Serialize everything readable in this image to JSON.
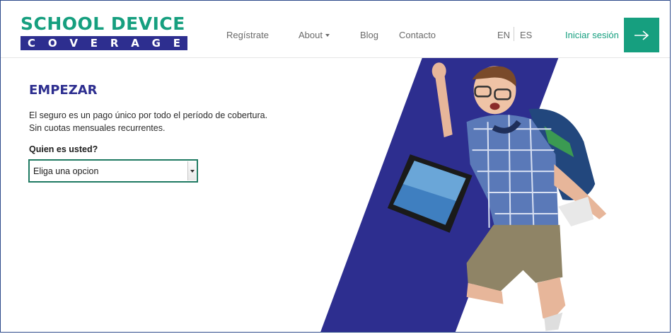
{
  "brand": {
    "line1": "SCHOOL DEVICE",
    "line2_letters": [
      "C",
      "O",
      "V",
      "E",
      "R",
      "A",
      "G",
      "E"
    ],
    "green": "#169f7f",
    "navy": "#2d2e8f"
  },
  "nav": {
    "items": [
      {
        "label": "Regístrate"
      },
      {
        "label": "About"
      },
      {
        "label": "Blog"
      },
      {
        "label": "Contacto"
      }
    ],
    "languages": [
      "EN",
      "ES"
    ],
    "login_label": "Iniciar sesión",
    "login_icon": "arrow-right-icon"
  },
  "main": {
    "title": "EMPEZAR",
    "intro_lines": [
      "El seguro es un pago único por todo el período de cobertura.",
      "Sin cuotas mensuales recurrentes."
    ],
    "field_label": "Quien es usted?",
    "select_value": "Eliga una opcion"
  }
}
